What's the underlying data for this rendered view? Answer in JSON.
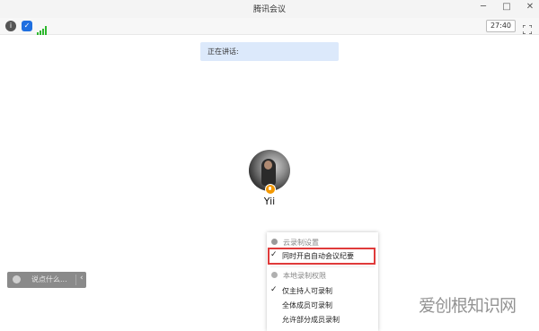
{
  "window": {
    "title": "腾讯会议"
  },
  "toolbar": {
    "timer": "27:40"
  },
  "speaking": {
    "label": "正在讲话:"
  },
  "participant": {
    "name": "Yii"
  },
  "chat": {
    "placeholder": "说点什么..."
  },
  "menu": {
    "cloud_header": "云录制设置",
    "auto_minutes": "同时开启自动会议纪要",
    "local_header": "本地录制权限",
    "host_only": "仅主持人可录制",
    "all_members": "全体成员可录制",
    "some_members": "允许部分成员录制"
  },
  "watermark": "爱创根知识网",
  "colors": {
    "speaking_bg": "#dce9fb",
    "highlight": "#e03b3b",
    "mic_badge": "#f39800",
    "signal": "#2eb82e",
    "shield": "#1f6fe0"
  }
}
